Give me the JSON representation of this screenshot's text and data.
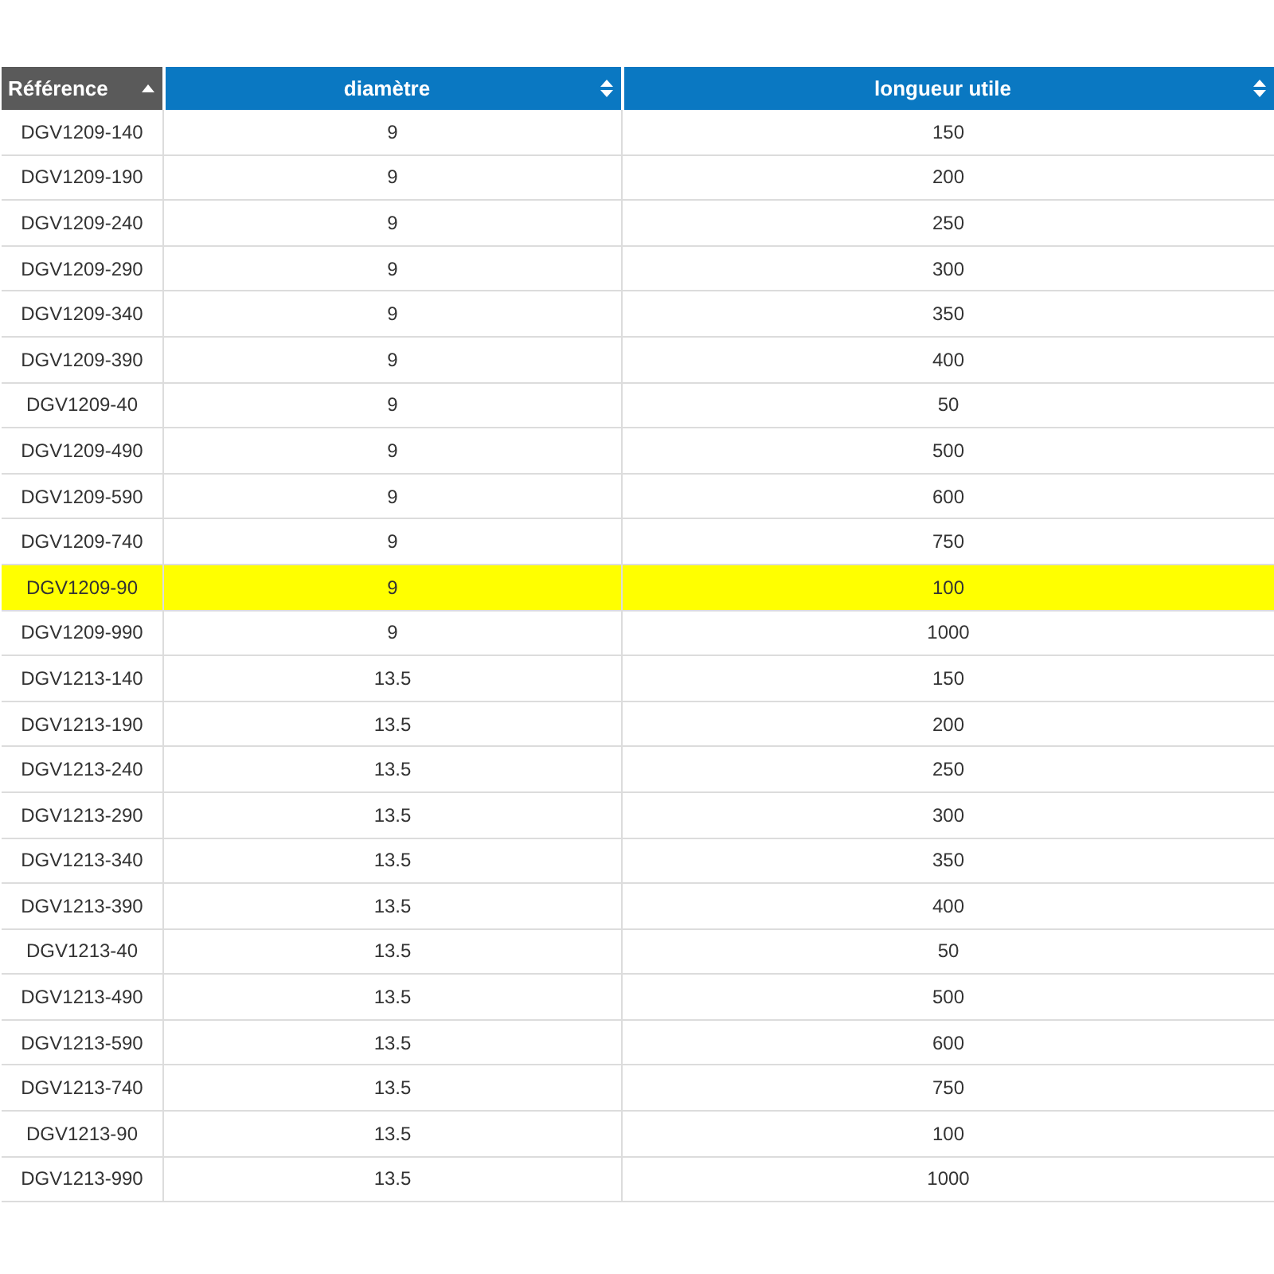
{
  "table": {
    "columns": [
      {
        "label": "Référence",
        "sorted": true
      },
      {
        "label": "diamètre",
        "sorted": false
      },
      {
        "label": "longueur utile",
        "sorted": false
      }
    ],
    "rows": [
      {
        "cells": [
          "DGV1209-140",
          "9",
          "150"
        ],
        "selected": false
      },
      {
        "cells": [
          "DGV1209-190",
          "9",
          "200"
        ],
        "selected": false
      },
      {
        "cells": [
          "DGV1209-240",
          "9",
          "250"
        ],
        "selected": false
      },
      {
        "cells": [
          "DGV1209-290",
          "9",
          "300"
        ],
        "selected": false
      },
      {
        "cells": [
          "DGV1209-340",
          "9",
          "350"
        ],
        "selected": false
      },
      {
        "cells": [
          "DGV1209-390",
          "9",
          "400"
        ],
        "selected": false
      },
      {
        "cells": [
          "DGV1209-40",
          "9",
          "50"
        ],
        "selected": false
      },
      {
        "cells": [
          "DGV1209-490",
          "9",
          "500"
        ],
        "selected": false
      },
      {
        "cells": [
          "DGV1209-590",
          "9",
          "600"
        ],
        "selected": false
      },
      {
        "cells": [
          "DGV1209-740",
          "9",
          "750"
        ],
        "selected": false
      },
      {
        "cells": [
          "DGV1209-90",
          "9",
          "100"
        ],
        "selected": true
      },
      {
        "cells": [
          "DGV1209-990",
          "9",
          "1000"
        ],
        "selected": false
      },
      {
        "cells": [
          "DGV1213-140",
          "13.5",
          "150"
        ],
        "selected": false
      },
      {
        "cells": [
          "DGV1213-190",
          "13.5",
          "200"
        ],
        "selected": false
      },
      {
        "cells": [
          "DGV1213-240",
          "13.5",
          "250"
        ],
        "selected": false
      },
      {
        "cells": [
          "DGV1213-290",
          "13.5",
          "300"
        ],
        "selected": false
      },
      {
        "cells": [
          "DGV1213-340",
          "13.5",
          "350"
        ],
        "selected": false
      },
      {
        "cells": [
          "DGV1213-390",
          "13.5",
          "400"
        ],
        "selected": false
      },
      {
        "cells": [
          "DGV1213-40",
          "13.5",
          "50"
        ],
        "selected": false
      },
      {
        "cells": [
          "DGV1213-490",
          "13.5",
          "500"
        ],
        "selected": false
      },
      {
        "cells": [
          "DGV1213-590",
          "13.5",
          "600"
        ],
        "selected": false
      },
      {
        "cells": [
          "DGV1213-740",
          "13.5",
          "750"
        ],
        "selected": false
      },
      {
        "cells": [
          "DGV1213-90",
          "13.5",
          "100"
        ],
        "selected": false
      },
      {
        "cells": [
          "DGV1213-990",
          "13.5",
          "1000"
        ],
        "selected": false
      }
    ]
  }
}
